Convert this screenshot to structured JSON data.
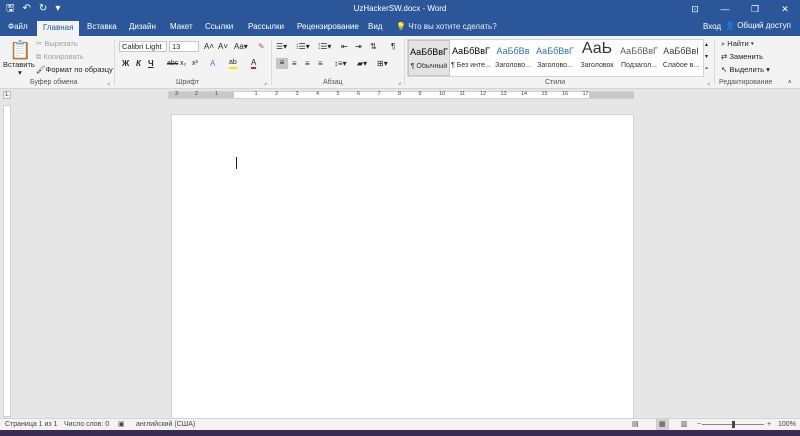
{
  "titlebar": {
    "title": "UzHackerSW.docx - Word",
    "qat": {
      "save_icon": "🖫",
      "undo_icon": "↶",
      "redo_icon": "↻",
      "customize_icon": "▾"
    },
    "win": {
      "ribbon_options": "⊡",
      "minimize": "—",
      "maximize": "❐",
      "close": "✕"
    }
  },
  "tabs": [
    "Файл",
    "Главная",
    "Вставка",
    "Дизайн",
    "Макет",
    "Ссылки",
    "Рассылки",
    "Рецензирование",
    "Вид"
  ],
  "tellme": "Что вы хотите сделать?",
  "signin": "Вход",
  "share": "Общий доступ",
  "clipboard": {
    "paste": "Вставить",
    "cut": "Вырезать",
    "copy": "Копировать",
    "format_painter": "Формат по образцу",
    "label": "Буфер обмена"
  },
  "font": {
    "name": "Calibri Light",
    "size": "13",
    "grow": "A",
    "shrink": "A",
    "case": "Aa",
    "clear": "✎",
    "bold": "Ж",
    "italic": "К",
    "underline": "Ч",
    "strike": "abc",
    "sub": "x₂",
    "sup": "x²",
    "effects": "A",
    "highlight": "ab",
    "color": "A",
    "label": "Шрифт"
  },
  "paragraph": {
    "label": "Абзац",
    "pilcrow": "¶"
  },
  "styles": {
    "items": [
      {
        "preview": "АаБбВвГ",
        "name": "¶ Обычный",
        "color": "#000000"
      },
      {
        "preview": "АаБбВвГ",
        "name": "¶ Без инте...",
        "color": "#000000"
      },
      {
        "preview": "АаБбВв",
        "name": "Заголово...",
        "color": "#2e74b5"
      },
      {
        "preview": "АаБбВвГ",
        "name": "Заголово...",
        "color": "#2e74b5"
      },
      {
        "preview": "АаЬ",
        "name": "Заголовок",
        "color": "#333333"
      },
      {
        "preview": "АаБбВвГ",
        "name": "Подзагол...",
        "color": "#5a5a5a"
      },
      {
        "preview": "АаБбВвІ",
        "name": "Слабое в...",
        "color": "#404040"
      }
    ],
    "label": "Стили"
  },
  "editing": {
    "find": "Найти",
    "replace": "Заменить",
    "select": "Выделить",
    "label": "Редактирование"
  },
  "ruler": {
    "numbers": [
      "3",
      "2",
      "1",
      "1",
      "2",
      "3",
      "4",
      "5",
      "6",
      "7",
      "8",
      "9",
      "10",
      "11",
      "12",
      "13",
      "14",
      "15",
      "16",
      "17"
    ]
  },
  "status": {
    "page": "Страница 1 из 1",
    "words": "Число слов: 0",
    "lang": "английский (США)",
    "zoom": "100%"
  },
  "colors": {
    "accent": "#2b579a",
    "heading": "#2e74b5"
  }
}
